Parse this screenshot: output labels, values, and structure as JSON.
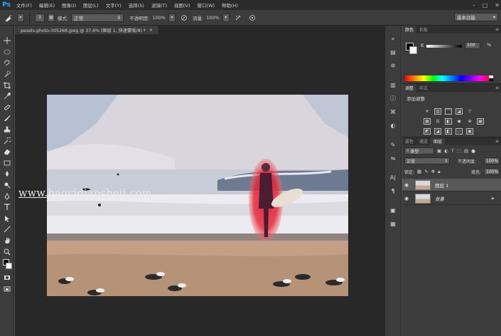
{
  "app": {
    "logo": "Ps"
  },
  "menu": [
    "文件(F)",
    "编辑(E)",
    "图像(I)",
    "图层(L)",
    "文字(Y)",
    "选择(S)",
    "滤镜(T)",
    "视图(V)",
    "窗口(W)",
    "帮助(H)"
  ],
  "window_controls": {
    "minimize": "–",
    "maximize": "□",
    "close": "✕"
  },
  "options_bar": {
    "brush_size": "9",
    "mode_label": "模式:",
    "mode_value": "正常",
    "opacity_label": "不透明度:",
    "opacity_value": "100%",
    "flow_label": "流量:",
    "flow_value": "100%",
    "workspace": "基本功能"
  },
  "document": {
    "tab_title": "pexels-photo-305268.jpeg @ 37.6% (图层 1, 快速蒙版/8) *",
    "close_glyph": "×",
    "watermark": "www.haoyidiapsheji.com"
  },
  "color_panel": {
    "tabs": [
      "颜色",
      "色板"
    ],
    "channel_label": "K",
    "value": "100",
    "unit": "%",
    "k_value": 100
  },
  "adjustments_panel": {
    "tabs": [
      "调整",
      "样式"
    ],
    "title": "添加调整"
  },
  "layers_panel": {
    "tabs": [
      "属性",
      "通道",
      "图层"
    ],
    "filter_type": "类型",
    "blend_mode": "正常",
    "opacity_label": "不透明度:",
    "opacity_value": "100%",
    "lock_label": "锁定:",
    "fill_label": "填充:",
    "fill_value": "100%",
    "layers": [
      {
        "name": "图层 1",
        "selected": true,
        "visible": true,
        "locked": false
      },
      {
        "name": "背景",
        "selected": false,
        "visible": true,
        "locked": true
      }
    ]
  },
  "colors": {
    "accent_logo": "#31a8ff",
    "quickmask_red": "#e8283c",
    "panel_bg": "#3c3c3c",
    "doc_bg": "#282828"
  }
}
